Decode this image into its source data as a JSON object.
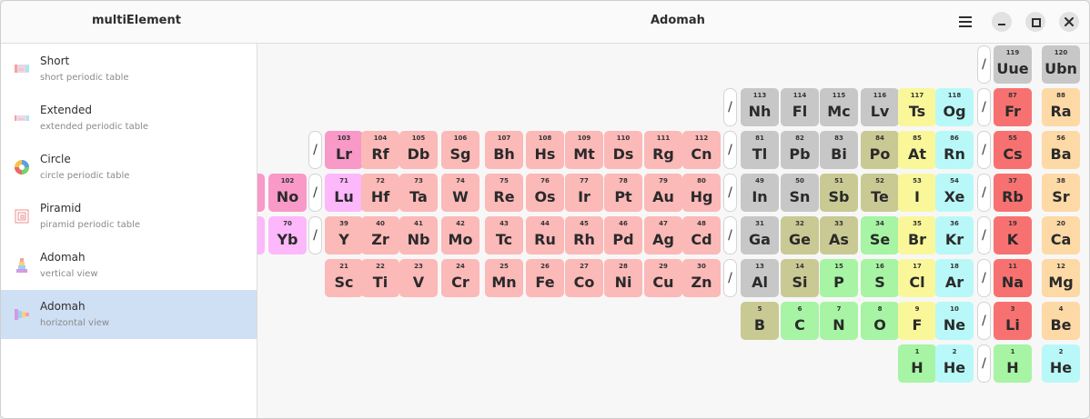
{
  "app": {
    "title": "multiElement"
  },
  "header": {
    "title": "Adomah"
  },
  "sidebar": {
    "items": [
      {
        "title": "Short",
        "subtitle": "short periodic table",
        "icon": "short-table-icon"
      },
      {
        "title": "Extended",
        "subtitle": "extended periodic table",
        "icon": "extended-table-icon"
      },
      {
        "title": "Circle",
        "subtitle": "circle periodic table",
        "icon": "circle-table-icon"
      },
      {
        "title": "Piramid",
        "subtitle": "piramid periodic table",
        "icon": "piramid-table-icon"
      },
      {
        "title": "Adomah",
        "subtitle": "vertical view",
        "icon": "adomah-vertical-icon"
      },
      {
        "title": "Adomah",
        "subtitle": "horizontal view",
        "icon": "adomah-horizontal-icon"
      }
    ],
    "selected_index": 5
  },
  "colors": {
    "alkali": "#f87171",
    "alkaline_earth": "#fdd9a6",
    "halogen": "#faf79a",
    "noble_gas": "#b9f8f8",
    "nonmetal": "#a6f4a4",
    "metalloid": "#c9c994",
    "post_transition": "#c7c7c7",
    "transition": "#fbb9b8",
    "lanthanide": "#fcb8fa",
    "actinide": "#f899c8",
    "selected_accent": "#cfdff4"
  },
  "elements": [
    {
      "n": "119",
      "s": "Uue",
      "cat": "post_transition"
    },
    {
      "n": "120",
      "s": "Ubn",
      "cat": "post_transition"
    },
    {
      "n": "113",
      "s": "Nh",
      "cat": "post_transition"
    },
    {
      "n": "114",
      "s": "Fl",
      "cat": "post_transition"
    },
    {
      "n": "115",
      "s": "Mc",
      "cat": "post_transition"
    },
    {
      "n": "116",
      "s": "Lv",
      "cat": "post_transition"
    },
    {
      "n": "117",
      "s": "Ts",
      "cat": "halogen"
    },
    {
      "n": "118",
      "s": "Og",
      "cat": "noble_gas"
    },
    {
      "n": "87",
      "s": "Fr",
      "cat": "alkali"
    },
    {
      "n": "88",
      "s": "Ra",
      "cat": "alkaline_earth"
    },
    {
      "n": "103",
      "s": "Lr",
      "cat": "actinide"
    },
    {
      "n": "104",
      "s": "Rf",
      "cat": "transition"
    },
    {
      "n": "105",
      "s": "Db",
      "cat": "transition"
    },
    {
      "n": "106",
      "s": "Sg",
      "cat": "transition"
    },
    {
      "n": "107",
      "s": "Bh",
      "cat": "transition"
    },
    {
      "n": "108",
      "s": "Hs",
      "cat": "transition"
    },
    {
      "n": "109",
      "s": "Mt",
      "cat": "transition"
    },
    {
      "n": "110",
      "s": "Ds",
      "cat": "transition"
    },
    {
      "n": "111",
      "s": "Rg",
      "cat": "transition"
    },
    {
      "n": "112",
      "s": "Cn",
      "cat": "transition"
    },
    {
      "n": "81",
      "s": "Tl",
      "cat": "post_transition"
    },
    {
      "n": "82",
      "s": "Pb",
      "cat": "post_transition"
    },
    {
      "n": "83",
      "s": "Bi",
      "cat": "post_transition"
    },
    {
      "n": "84",
      "s": "Po",
      "cat": "metalloid"
    },
    {
      "n": "85",
      "s": "At",
      "cat": "halogen"
    },
    {
      "n": "86",
      "s": "Rn",
      "cat": "noble_gas"
    },
    {
      "n": "55",
      "s": "Cs",
      "cat": "alkali"
    },
    {
      "n": "56",
      "s": "Ba",
      "cat": "alkaline_earth"
    },
    {
      "n": "102",
      "s": "No",
      "cat": "actinide"
    },
    {
      "n": "71",
      "s": "Lu",
      "cat": "lanthanide"
    },
    {
      "n": "72",
      "s": "Hf",
      "cat": "transition"
    },
    {
      "n": "73",
      "s": "Ta",
      "cat": "transition"
    },
    {
      "n": "74",
      "s": "W",
      "cat": "transition"
    },
    {
      "n": "75",
      "s": "Re",
      "cat": "transition"
    },
    {
      "n": "76",
      "s": "Os",
      "cat": "transition"
    },
    {
      "n": "77",
      "s": "Ir",
      "cat": "transition"
    },
    {
      "n": "78",
      "s": "Pt",
      "cat": "transition"
    },
    {
      "n": "79",
      "s": "Au",
      "cat": "transition"
    },
    {
      "n": "80",
      "s": "Hg",
      "cat": "transition"
    },
    {
      "n": "49",
      "s": "In",
      "cat": "post_transition"
    },
    {
      "n": "50",
      "s": "Sn",
      "cat": "post_transition"
    },
    {
      "n": "51",
      "s": "Sb",
      "cat": "metalloid"
    },
    {
      "n": "52",
      "s": "Te",
      "cat": "metalloid"
    },
    {
      "n": "53",
      "s": "I",
      "cat": "halogen"
    },
    {
      "n": "54",
      "s": "Xe",
      "cat": "noble_gas"
    },
    {
      "n": "37",
      "s": "Rb",
      "cat": "alkali"
    },
    {
      "n": "38",
      "s": "Sr",
      "cat": "alkaline_earth"
    },
    {
      "n": "70",
      "s": "Yb",
      "cat": "lanthanide"
    },
    {
      "n": "39",
      "s": "Y",
      "cat": "transition"
    },
    {
      "n": "40",
      "s": "Zr",
      "cat": "transition"
    },
    {
      "n": "41",
      "s": "Nb",
      "cat": "transition"
    },
    {
      "n": "42",
      "s": "Mo",
      "cat": "transition"
    },
    {
      "n": "43",
      "s": "Tc",
      "cat": "transition"
    },
    {
      "n": "44",
      "s": "Ru",
      "cat": "transition"
    },
    {
      "n": "45",
      "s": "Rh",
      "cat": "transition"
    },
    {
      "n": "46",
      "s": "Pd",
      "cat": "transition"
    },
    {
      "n": "47",
      "s": "Ag",
      "cat": "transition"
    },
    {
      "n": "48",
      "s": "Cd",
      "cat": "transition"
    },
    {
      "n": "31",
      "s": "Ga",
      "cat": "post_transition"
    },
    {
      "n": "32",
      "s": "Ge",
      "cat": "metalloid"
    },
    {
      "n": "33",
      "s": "As",
      "cat": "metalloid"
    },
    {
      "n": "34",
      "s": "Se",
      "cat": "nonmetal"
    },
    {
      "n": "35",
      "s": "Br",
      "cat": "halogen"
    },
    {
      "n": "36",
      "s": "Kr",
      "cat": "noble_gas"
    },
    {
      "n": "19",
      "s": "K",
      "cat": "alkali"
    },
    {
      "n": "20",
      "s": "Ca",
      "cat": "alkaline_earth"
    },
    {
      "n": "21",
      "s": "Sc",
      "cat": "transition"
    },
    {
      "n": "22",
      "s": "Ti",
      "cat": "transition"
    },
    {
      "n": "23",
      "s": "V",
      "cat": "transition"
    },
    {
      "n": "24",
      "s": "Cr",
      "cat": "transition"
    },
    {
      "n": "25",
      "s": "Mn",
      "cat": "transition"
    },
    {
      "n": "26",
      "s": "Fe",
      "cat": "transition"
    },
    {
      "n": "27",
      "s": "Co",
      "cat": "transition"
    },
    {
      "n": "28",
      "s": "Ni",
      "cat": "transition"
    },
    {
      "n": "29",
      "s": "Cu",
      "cat": "transition"
    },
    {
      "n": "30",
      "s": "Zn",
      "cat": "transition"
    },
    {
      "n": "13",
      "s": "Al",
      "cat": "post_transition"
    },
    {
      "n": "14",
      "s": "Si",
      "cat": "metalloid"
    },
    {
      "n": "15",
      "s": "P",
      "cat": "nonmetal"
    },
    {
      "n": "16",
      "s": "S",
      "cat": "nonmetal"
    },
    {
      "n": "17",
      "s": "Cl",
      "cat": "halogen"
    },
    {
      "n": "18",
      "s": "Ar",
      "cat": "noble_gas"
    },
    {
      "n": "11",
      "s": "Na",
      "cat": "alkali"
    },
    {
      "n": "12",
      "s": "Mg",
      "cat": "alkaline_earth"
    },
    {
      "n": "5",
      "s": "B",
      "cat": "metalloid"
    },
    {
      "n": "6",
      "s": "C",
      "cat": "nonmetal"
    },
    {
      "n": "7",
      "s": "N",
      "cat": "nonmetal"
    },
    {
      "n": "8",
      "s": "O",
      "cat": "nonmetal"
    },
    {
      "n": "9",
      "s": "F",
      "cat": "halogen"
    },
    {
      "n": "10",
      "s": "Ne",
      "cat": "noble_gas"
    },
    {
      "n": "3",
      "s": "Li",
      "cat": "alkali"
    },
    {
      "n": "4",
      "s": "Be",
      "cat": "alkaline_earth"
    },
    {
      "n": "1",
      "s": "H",
      "cat": "nonmetal"
    },
    {
      "n": "2",
      "s": "He",
      "cat": "noble_gas"
    },
    {
      "n": "1",
      "s": "H",
      "cat": "nonmetal"
    },
    {
      "n": "2",
      "s": "He",
      "cat": "noble_gas"
    }
  ],
  "partial_cells": [
    {
      "cat": "actinide"
    },
    {
      "cat": "lanthanide"
    }
  ],
  "separators": {
    "symbol": "/"
  }
}
